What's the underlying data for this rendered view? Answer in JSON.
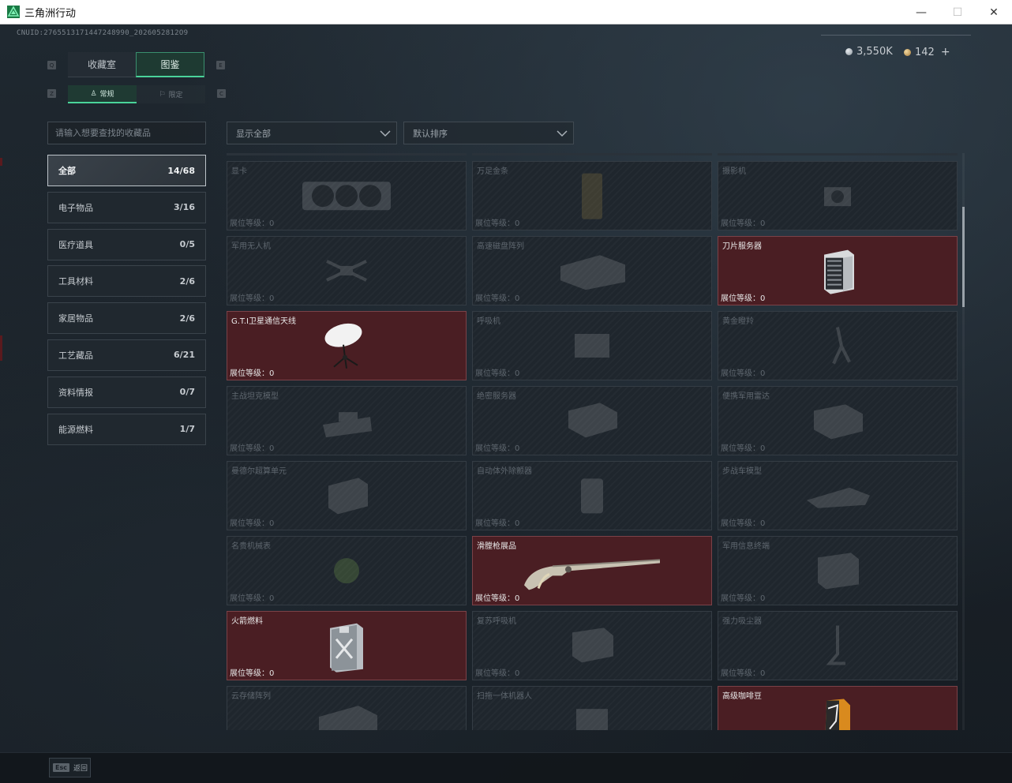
{
  "window": {
    "title": "三角洲行动",
    "minimize": "—",
    "maximize": "☐",
    "close": "✕"
  },
  "header": {
    "uid": "CNUID:2765513171447248990_2026052812O9",
    "currency_1": "3,550K",
    "currency_2": "142",
    "plus": "+"
  },
  "tabs": {
    "q_key": "Q",
    "e_key": "E",
    "collection": "收藏室",
    "codex": "图鉴",
    "z_key": "Z",
    "c_key": "C",
    "normal": "常规",
    "limited": "限定"
  },
  "search": {
    "placeholder": "请输入想要查找的收藏品"
  },
  "categories": [
    {
      "label": "全部",
      "count": "14/68"
    },
    {
      "label": "电子物品",
      "count": "3/16"
    },
    {
      "label": "医疗道具",
      "count": "0/5"
    },
    {
      "label": "工具材料",
      "count": "2/6"
    },
    {
      "label": "家居物品",
      "count": "2/6"
    },
    {
      "label": "工艺藏品",
      "count": "6/21"
    },
    {
      "label": "资料情报",
      "count": "0/7"
    },
    {
      "label": "能源燃料",
      "count": "1/7"
    }
  ],
  "filters": {
    "show": "显示全部",
    "sort": "默认排序"
  },
  "level_label": "展位等级：",
  "items": [
    {
      "name": "显卡",
      "level": "0",
      "owned": false,
      "icon": "gpu-icon"
    },
    {
      "name": "万足金条",
      "level": "0",
      "owned": false,
      "icon": "gold-bar-icon"
    },
    {
      "name": "摄影机",
      "level": "0",
      "owned": false,
      "icon": "camera-icon"
    },
    {
      "name": "军用无人机",
      "level": "0",
      "owned": false,
      "icon": "drone-icon"
    },
    {
      "name": "高速磁盘阵列",
      "level": "0",
      "owned": false,
      "icon": "disk-array-icon"
    },
    {
      "name": "刀片服务器",
      "level": "0",
      "owned": true,
      "icon": "server-icon"
    },
    {
      "name": "G.T.I卫星通信天线",
      "level": "0",
      "owned": true,
      "icon": "satellite-dish-icon"
    },
    {
      "name": "呼吸机",
      "level": "0",
      "owned": false,
      "icon": "ventilator-icon"
    },
    {
      "name": "黄金瞪羚",
      "level": "0",
      "owned": false,
      "icon": "gazelle-icon"
    },
    {
      "name": "主战坦克模型",
      "level": "0",
      "owned": false,
      "icon": "tank-icon"
    },
    {
      "name": "绝密服务器",
      "level": "0",
      "owned": false,
      "icon": "secret-server-icon"
    },
    {
      "name": "便携军用雷达",
      "level": "0",
      "owned": false,
      "icon": "radar-icon"
    },
    {
      "name": "曼德尔超算单元",
      "level": "0",
      "owned": false,
      "icon": "compute-unit-icon"
    },
    {
      "name": "自动体外除颤器",
      "level": "0",
      "owned": false,
      "icon": "defibrillator-icon"
    },
    {
      "name": "步战车模型",
      "level": "0",
      "owned": false,
      "icon": "ifv-icon"
    },
    {
      "name": "名贵机械表",
      "level": "0",
      "owned": false,
      "icon": "watch-icon"
    },
    {
      "name": "滑膛枪展品",
      "level": "0",
      "owned": true,
      "icon": "musket-icon"
    },
    {
      "name": "军用信息终端",
      "level": "0",
      "owned": false,
      "icon": "terminal-icon"
    },
    {
      "name": "火箭燃料",
      "level": "0",
      "owned": true,
      "icon": "fuel-can-icon"
    },
    {
      "name": "复苏呼吸机",
      "level": "0",
      "owned": false,
      "icon": "resuscitator-icon"
    },
    {
      "name": "强力吸尘器",
      "level": "0",
      "owned": false,
      "icon": "vacuum-icon"
    },
    {
      "name": "云存储阵列",
      "level": "0",
      "owned": false,
      "icon": "storage-array-icon"
    },
    {
      "name": "扫拖一体机器人",
      "level": "0",
      "owned": false,
      "icon": "robot-vacuum-icon"
    },
    {
      "name": "高级咖啡豆",
      "level": "0",
      "owned": true,
      "icon": "coffee-bag-icon"
    }
  ],
  "footer": {
    "esc_key": "Esc",
    "back": "返回"
  },
  "colors": {
    "accent": "#4ad39a",
    "owned_card": "#4a1e23",
    "locked_card": "#1f262d"
  }
}
